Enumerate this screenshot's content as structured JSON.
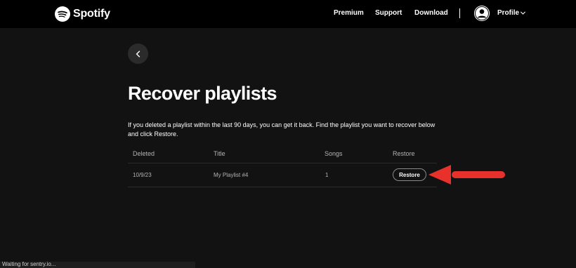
{
  "app": {
    "brand_name": "Spotify",
    "accent_color": "#1DB954",
    "annotation_color": "#E8312A"
  },
  "nav": {
    "items": [
      {
        "label": "Premium"
      },
      {
        "label": "Support"
      },
      {
        "label": "Download"
      }
    ],
    "profile_label": "Profile"
  },
  "page": {
    "title": "Recover playlists",
    "description": "If you deleted a playlist within the last 90 days, you can get it back. Find the playlist you want to recover below and click Restore."
  },
  "table": {
    "columns": [
      "Deleted",
      "Title",
      "Songs",
      "Restore"
    ],
    "rows": [
      {
        "deleted": "10/9/23",
        "title": "My Playlist #4",
        "songs": "1",
        "action": "Restore"
      }
    ]
  },
  "icons": {
    "brand": "spotify-logo-icon",
    "avatar": "user-avatar-icon",
    "chevron": "chevron-down-icon",
    "back": "chevron-left-icon",
    "annotation": "red-arrow-icon"
  },
  "status_bar": {
    "text": "Waiting for sentry.io..."
  }
}
